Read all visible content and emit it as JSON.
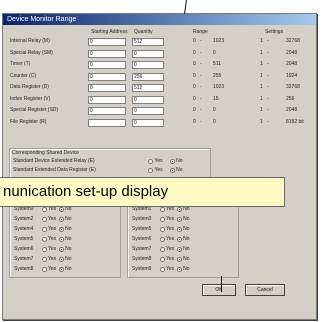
{
  "dialog": {
    "title": "Device Monitor Range",
    "columns": [
      "Starting Address",
      "Quantity",
      "Range",
      "Settings"
    ],
    "rows": [
      {
        "label": "Internal Relay (M)",
        "start": "0",
        "quantity": "512",
        "min": "0",
        "max": "1023",
        "smin": "1",
        "smax": "32768"
      },
      {
        "label": "Special Relay (SM)",
        "start": "0",
        "quantity": "0",
        "min": "0",
        "max": "0",
        "smin": "1",
        "smax": "2048"
      },
      {
        "label": "Timer (T)",
        "start": "0",
        "quantity": "0",
        "min": "0",
        "max": "511",
        "smin": "1",
        "smax": "2048"
      },
      {
        "label": "Counter (C)",
        "start": "0",
        "quantity": "256",
        "min": "0",
        "max": "255",
        "smin": "1",
        "smax": "1024"
      },
      {
        "label": "Data Register (D)",
        "start": "0",
        "quantity": "512",
        "min": "0",
        "max": "1023",
        "smin": "1",
        "smax": "32768"
      },
      {
        "label": "Index Register (V)",
        "start": "0",
        "quantity": "0",
        "min": "0",
        "max": "15",
        "smin": "1",
        "smax": "256"
      },
      {
        "label": "Special Register (SD)",
        "start": "0",
        "quantity": "0",
        "min": "0",
        "max": "0",
        "smin": "1",
        "smax": "2048"
      },
      {
        "label": "File Register (R)",
        "start": "",
        "quantity": "0",
        "min": "0",
        "max": "0",
        "smin": "1",
        "smax": "8192 bit"
      }
    ],
    "interlock": {
      "group_label": "Corresponding Shared Device",
      "lines": [
        {
          "label": "Standard Device Extended Relay (E)",
          "yes": "Yes",
          "no": "No",
          "selected": "no"
        },
        {
          "label": "Standard Extended Data Register (E)",
          "yes": "Yes",
          "no": "No",
          "selected": "no"
        }
      ]
    },
    "systems_left": [
      {
        "name": "System0",
        "yes": "Yes",
        "no": "No",
        "selected": "no"
      },
      {
        "name": "System2",
        "yes": "Yes",
        "no": "No",
        "selected": "no"
      },
      {
        "name": "System4",
        "yes": "Yes",
        "no": "No",
        "selected": "no"
      },
      {
        "name": "System5",
        "yes": "Yes",
        "no": "No",
        "selected": "no"
      },
      {
        "name": "System6",
        "yes": "Yes",
        "no": "No",
        "selected": "no"
      },
      {
        "name": "System7",
        "yes": "Yes",
        "no": "No",
        "selected": "no"
      },
      {
        "name": "System8",
        "yes": "Yes",
        "no": "No",
        "selected": "no"
      }
    ],
    "systems_right": [
      {
        "name": "System1",
        "yes": "Yes",
        "no": "No",
        "selected": "no"
      },
      {
        "name": "System3",
        "yes": "Yes",
        "no": "No",
        "selected": "no"
      },
      {
        "name": "System5",
        "yes": "Yes",
        "no": "No",
        "selected": "no"
      },
      {
        "name": "System6",
        "yes": "Yes",
        "no": "No",
        "selected": "no"
      },
      {
        "name": "System7",
        "yes": "Yes",
        "no": "No",
        "selected": "no"
      },
      {
        "name": "System8",
        "yes": "Yes",
        "no": "No",
        "selected": "no"
      },
      {
        "name": "System9",
        "yes": "Yes",
        "no": "No",
        "selected": "no"
      }
    ],
    "ok_label": "OK",
    "cancel_label": "Cancel"
  },
  "tooltip": {
    "text": "nunication set-up display"
  },
  "colors": {
    "title_bar": "#0a246a",
    "dialog_face": "#d4d0c8",
    "tooltip_bg": "#fff9c4"
  }
}
